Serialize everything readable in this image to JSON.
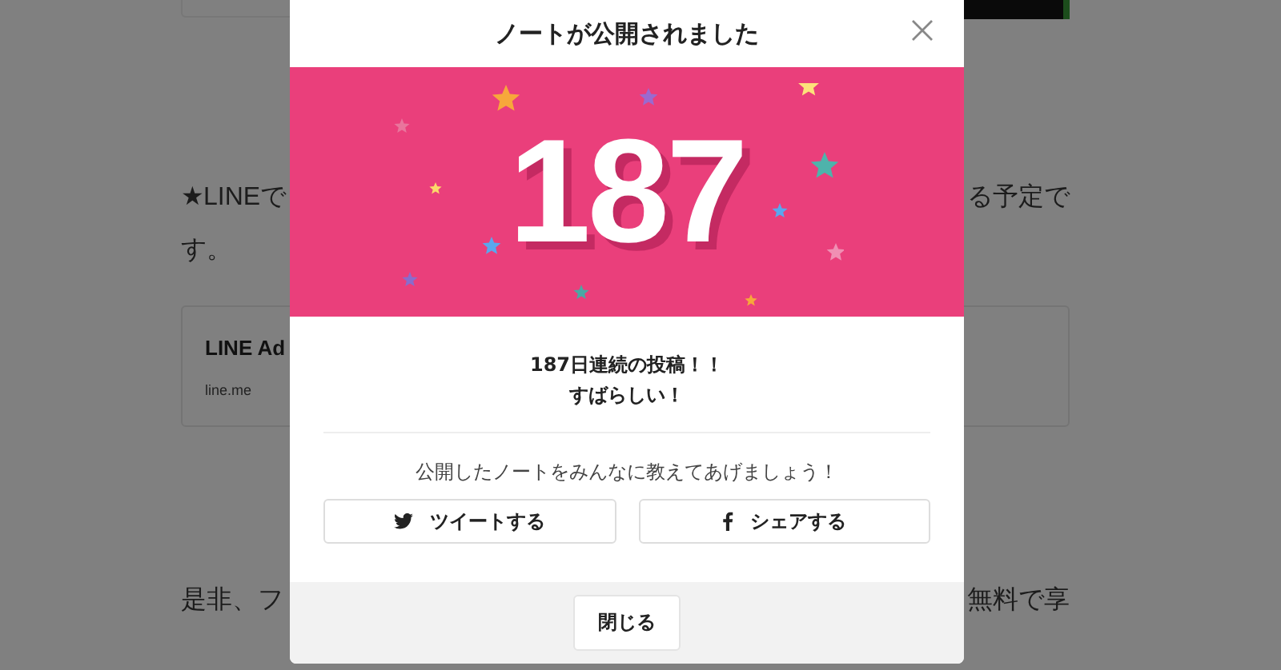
{
  "background_page": {
    "paragraph_start": "★LINEで",
    "paragraph_end": "る予定で",
    "paragraph_tail": "す。",
    "link_card": {
      "title": "LINE Ad",
      "domain": "line.me"
    },
    "next_start": "是非、フ",
    "next_end": "無料で享"
  },
  "dialog": {
    "title": "ノートが公開されました",
    "streak_number": "187",
    "message_lines": [
      "187日連続の投稿！！",
      "すばらしい！"
    ],
    "share_prompt": "公開したノートをみんなに教えてあげましょう！",
    "share_buttons": [
      {
        "kind": "twitter",
        "label": "ツイートする"
      },
      {
        "kind": "facebook",
        "label": "シェアする"
      }
    ],
    "close_button": "閉じる"
  }
}
